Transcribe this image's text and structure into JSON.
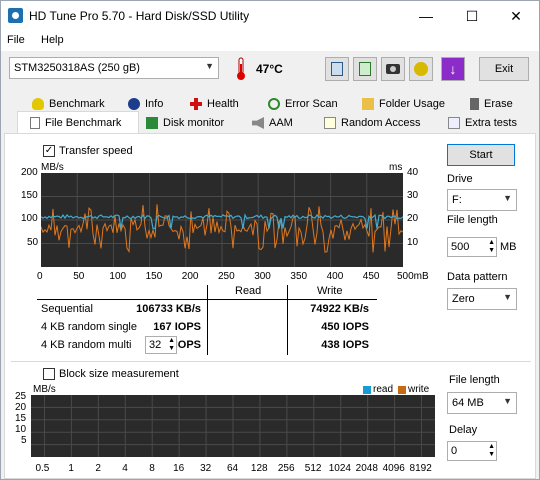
{
  "window": {
    "title": "HD Tune Pro 5.70 - Hard Disk/SSD Utility",
    "minimize": "—",
    "maximize": "☐",
    "close": "✕"
  },
  "menu": {
    "file": "File",
    "help": "Help"
  },
  "toolbar": {
    "drive": "STM3250318AS (250 gB)",
    "temperature": "47°C",
    "exit": "Exit"
  },
  "tabs_row1": [
    "Benchmark",
    "Info",
    "Health",
    "Error Scan",
    "Folder Usage",
    "Erase"
  ],
  "tabs_row2": [
    "File Benchmark",
    "Disk monitor",
    "AAM",
    "Random Access",
    "Extra tests"
  ],
  "file_benchmark": {
    "transfer_speed_label": "Transfer speed",
    "transfer_speed_checked": true,
    "chart_data": {
      "type": "line",
      "ylabel_left": "MB/s",
      "ylabel_right": "ms",
      "y_left_ticks": [
        "200",
        "150",
        "100",
        "50"
      ],
      "y_right_ticks": [
        "40",
        "30",
        "20",
        "10"
      ],
      "ylim_left": [
        0,
        200
      ],
      "ylim_right": [
        0,
        40
      ],
      "x_ticks": [
        "0",
        "50",
        "100",
        "150",
        "200",
        "250",
        "300",
        "350",
        "400",
        "450",
        "500mB"
      ],
      "xlim": [
        0,
        500
      ],
      "series": [
        {
          "name": "read",
          "color": "#44aacc",
          "axis": "left",
          "approx_level": 107
        },
        {
          "name": "write",
          "color": "#e07820",
          "axis": "right",
          "approx_range": [
            6,
            27
          ]
        }
      ]
    },
    "results": {
      "header_read": "Read",
      "header_write": "Write",
      "rows": [
        {
          "label": "Sequential",
          "read": "106733 KB/s",
          "write": "74922 KB/s"
        },
        {
          "label": "4 KB random single",
          "read": "167 IOPS",
          "write": "450 IOPS"
        },
        {
          "label": "4 KB random multi",
          "read": "169 IOPS",
          "write": "438 IOPS"
        }
      ],
      "queue_depth": "32"
    },
    "start": "Start",
    "drive_label": "Drive",
    "drive_value": "F:",
    "file_length_label": "File length",
    "file_length_value": "500",
    "file_length_unit": "MB",
    "data_pattern_label": "Data pattern",
    "data_pattern_value": "Zero"
  },
  "block_size": {
    "label": "Block size measurement",
    "checked": false,
    "chart_data": {
      "type": "bar",
      "ylabel": "MB/s",
      "y_ticks": [
        "25",
        "20",
        "15",
        "10",
        "5"
      ],
      "ylim": [
        0,
        25
      ],
      "categories": [
        "0.5",
        "1",
        "2",
        "4",
        "8",
        "16",
        "32",
        "64",
        "128",
        "256",
        "512",
        "1024",
        "2048",
        "4096",
        "8192"
      ],
      "legend": [
        "read",
        "write"
      ],
      "legend_colors": [
        "#1a9bd7",
        "#c86a14"
      ],
      "values_read": [],
      "values_write": []
    },
    "file_length_label": "File length",
    "file_length_value": "64 MB",
    "delay_label": "Delay",
    "delay_value": "0"
  },
  "colors": {
    "chart_bg": "#2a2a2a",
    "grid": "#4a4a4a",
    "read": "#44aacc",
    "write": "#e07820"
  }
}
